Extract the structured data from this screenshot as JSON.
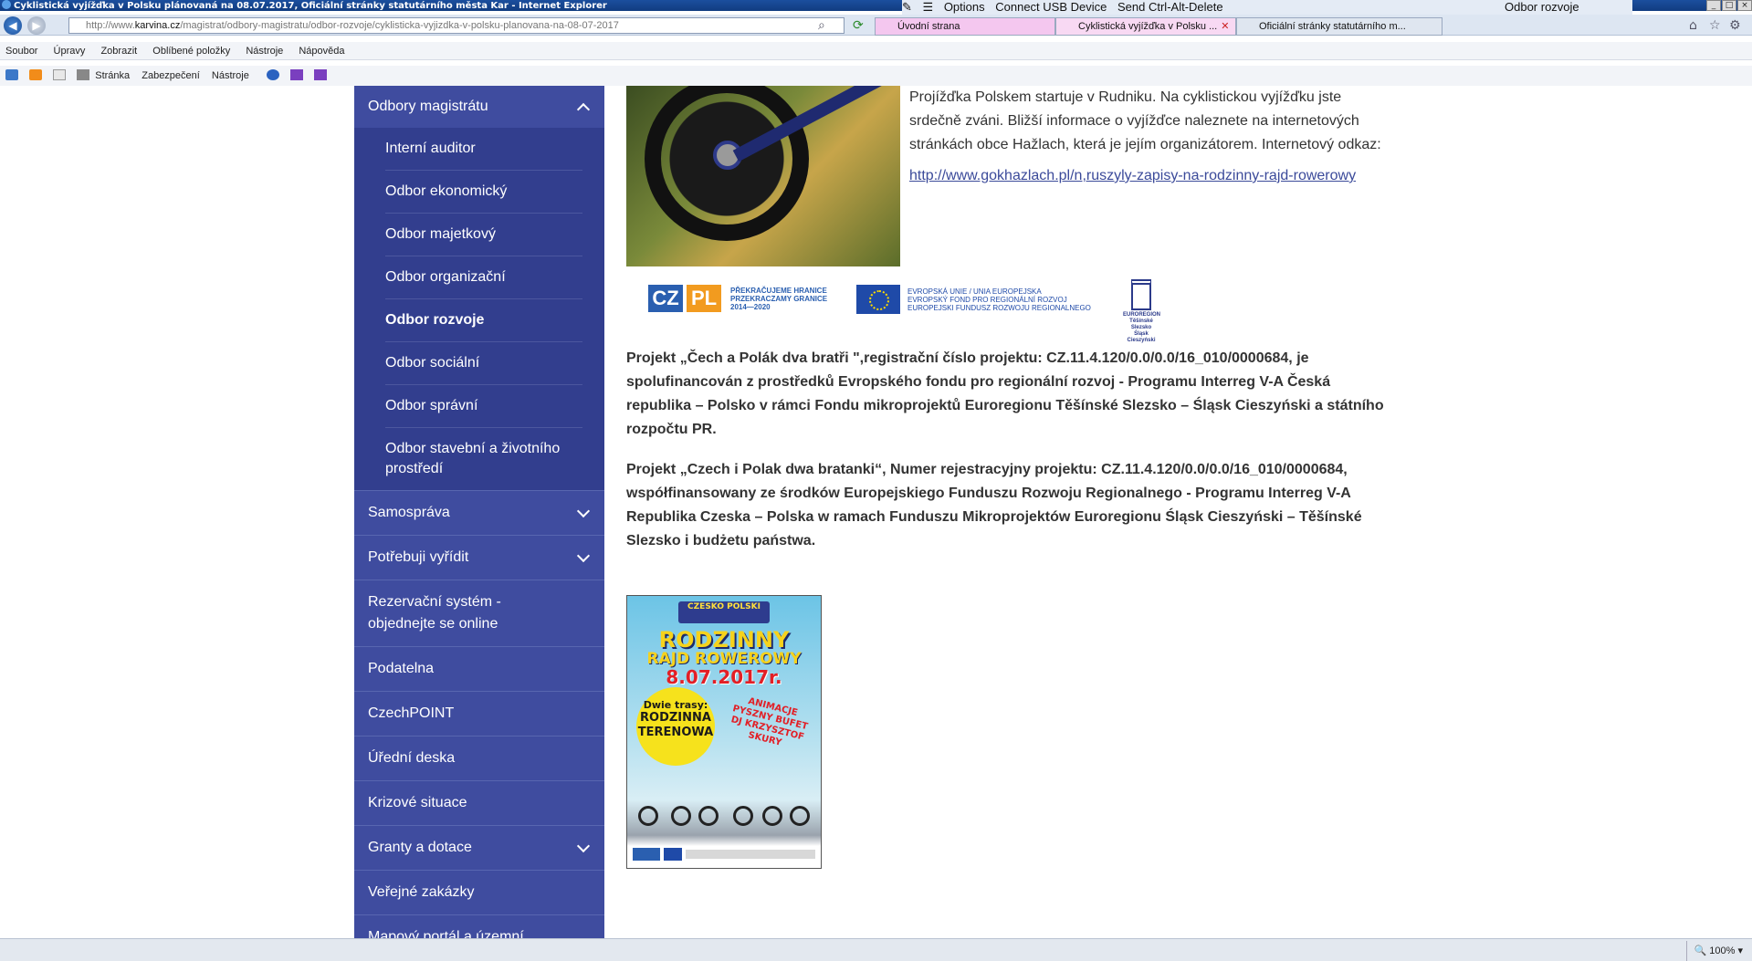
{
  "window": {
    "title": "Cyklistická vyjížďka v Polsku plánovaná na 08.07.2017, Oficiální stránky statutárního města Kar - Internet Explorer",
    "tools": [
      "Options",
      "Connect USB Device",
      "Send Ctrl-Alt-Delete"
    ],
    "section_label": "Odbor rozvoje"
  },
  "address": {
    "prefix": "http://www.",
    "domain": "karvina.cz",
    "path": "/magistrat/odbory-magistratu/odbor-rozvoje/cyklisticka-vyjizdka-v-polsku-planovana-na-08-07-2017"
  },
  "tabs": [
    {
      "label": "Úvodní strana"
    },
    {
      "label": "Cyklistická vyjížďka v Polsku ..."
    },
    {
      "label": "Oficiální stránky statutárního m..."
    }
  ],
  "menu": [
    "Soubor",
    "Úpravy",
    "Zobrazit",
    "Oblíbené položky",
    "Nástroje",
    "Nápověda"
  ],
  "commandbar": {
    "page": "Stránka",
    "security": "Zabezpečení",
    "tools": "Nástroje"
  },
  "sidebar": {
    "header": "Odbory magistrátu",
    "subitems": [
      "Interní auditor",
      "Odbor ekonomický",
      "Odbor majetkový",
      "Odbor organizační",
      "Odbor rozvoje",
      "Odbor sociální",
      "Odbor správní",
      "Odbor stavební a životního prostředí"
    ],
    "items": [
      "Samospráva",
      "Potřebuji vyřídit",
      "Rezervační systém - objednejte se online",
      "Podatelna",
      "CzechPOINT",
      "Úřední deska",
      "Krizové situace",
      "Granty a dotace",
      "Veřejné zakázky",
      "Mapový portál a územní"
    ]
  },
  "content": {
    "intro": "Projížďka Polskem startuje v Rudniku. Na cyklistickou vyjížďku jste srdečně zváni. Bližší informace o vyjížďce naleznete na internetových stránkách obce Hažlach, která je jejím organizátorem. Internetový odkaz:",
    "link": "http://www.gokhazlach.pl/n,ruszyly-zapisy-na-rodzinny-rajd-rowerowy",
    "logos": {
      "cz": "CZ",
      "pl": "PL",
      "cz_text_1": "PŘEKRAČUJEME HRANICE",
      "cz_text_2": "PRZEKRACZAMY GRANICE",
      "cz_text_3": "2014—2020",
      "eu_text_1": "EVROPSKÁ UNIE / UNIA EUROPEJSKA",
      "eu_text_2": "EVROPSKÝ FOND PRO REGIONÁLNÍ ROZVOJ",
      "eu_text_3": "EUROPEJSKI FUNDUSZ ROZWOJU REGIONALNEGO",
      "euroregion_1": "EUROREGION",
      "euroregion_2": "Těšínské Slezsko",
      "euroregion_3": "Śląsk Cieszyński"
    },
    "para_cz": "Projekt „Čech a Polák dva bratři \",registrační číslo projektu: CZ.11.4.120/0.0/0.0/16_010/0000684, je spolufinancován z prostředků Evropského fondu pro regionální rozvoj - Programu Interreg V-A Česká republika – Polsko v rámci Fondu mikroprojektů Euroregionu Těšínské Slezsko – Śląsk Cieszyński a státního rozpočtu PR.",
    "para_pl": "Projekt „Czech i Polak dwa bratanki“, Numer rejestracyjny projektu: CZ.11.4.120/0.0/0.0/16_010/0000684, współfinansowany ze środków Europejskiego Funduszu Rozwoju Regionalnego - Programu Interreg V-A Republika Czeska – Polska w ramach Funduszu Mikroprojektów Euroregionu Śląsk Cieszyński – Těšínské Slezsko i budżetu państwa.",
    "poster": {
      "band": "CZESKO POLSKI",
      "title_1": "RODZINNY",
      "title_2": "RAJD ROWEROWY",
      "date": "8.07.2017r.",
      "route_1": "Dwie trasy:",
      "route_2": "RODZINNA",
      "route_3": "TERENOWA",
      "anim": "ANIMACJE PYSZNY BUFET DJ KRZYSZTOF SKURY"
    }
  },
  "status": {
    "zoom": "100%"
  }
}
